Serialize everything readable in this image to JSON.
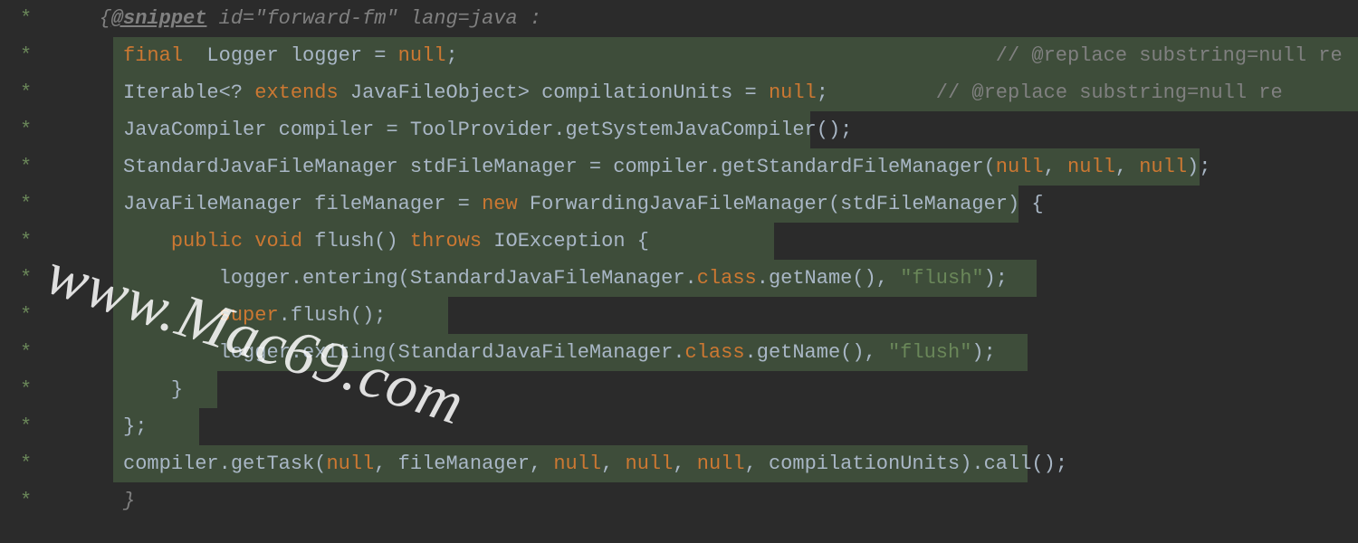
{
  "gutter_char": "*",
  "lines": [
    {
      "indent": "   ",
      "highlight": false,
      "tokens": [
        {
          "t": "{",
          "c": "comment-italic"
        },
        {
          "t": "@snippet",
          "c": "snippet-tag"
        },
        {
          "t": " id=\"forward-fm\" lang=java :",
          "c": "comment-italic"
        }
      ]
    },
    {
      "indent": "     ",
      "highlight": true,
      "hl_start": 55,
      "hl_width": 1445,
      "tokens": [
        {
          "t": "final",
          "c": "keyword"
        },
        {
          "t": "  Logger logger = ",
          "c": "identifier"
        },
        {
          "t": "null",
          "c": "keyword"
        },
        {
          "t": ";                                             ",
          "c": "identifier"
        },
        {
          "t": "// @replace substring=null re",
          "c": "comment"
        }
      ]
    },
    {
      "indent": "     ",
      "highlight": true,
      "hl_start": 55,
      "hl_width": 1445,
      "tokens": [
        {
          "t": "Iterable<? ",
          "c": "identifier"
        },
        {
          "t": "extends",
          "c": "keyword"
        },
        {
          "t": " JavaFileObject> compilationUnits = ",
          "c": "identifier"
        },
        {
          "t": "null",
          "c": "keyword"
        },
        {
          "t": ";         ",
          "c": "identifier"
        },
        {
          "t": "// @replace substring=null re",
          "c": "comment"
        }
      ]
    },
    {
      "indent": "     ",
      "highlight": true,
      "hl_start": 55,
      "hl_width": 770,
      "tokens": [
        {
          "t": "JavaCompiler compiler = ToolProvider.getSystemJavaCompiler();",
          "c": "identifier"
        }
      ]
    },
    {
      "indent": "     ",
      "highlight": true,
      "hl_start": 55,
      "hl_width": 1200,
      "tokens": [
        {
          "t": "StandardJavaFileManager stdFileManager = compiler.getStandardFileManager(",
          "c": "identifier"
        },
        {
          "t": "null",
          "c": "keyword"
        },
        {
          "t": ", ",
          "c": "identifier"
        },
        {
          "t": "null",
          "c": "keyword"
        },
        {
          "t": ", ",
          "c": "identifier"
        },
        {
          "t": "null",
          "c": "keyword"
        },
        {
          "t": ");",
          "c": "identifier"
        }
      ]
    },
    {
      "indent": "     ",
      "highlight": true,
      "hl_start": 55,
      "hl_width": 1000,
      "tokens": [
        {
          "t": "JavaFileManager fileManager = ",
          "c": "identifier"
        },
        {
          "t": "new",
          "c": "keyword"
        },
        {
          "t": " ForwardingJavaFileManager(stdFileManager) {",
          "c": "identifier"
        }
      ]
    },
    {
      "indent": "         ",
      "highlight": true,
      "hl_start": 55,
      "hl_width": 730,
      "tokens": [
        {
          "t": "public void",
          "c": "keyword"
        },
        {
          "t": " flush() ",
          "c": "identifier"
        },
        {
          "t": "throws",
          "c": "keyword"
        },
        {
          "t": " IOException {",
          "c": "identifier"
        }
      ]
    },
    {
      "indent": "             ",
      "highlight": true,
      "hl_start": 55,
      "hl_width": 1020,
      "tokens": [
        {
          "t": "logger.entering(StandardJavaFileManager.",
          "c": "identifier"
        },
        {
          "t": "class",
          "c": "keyword"
        },
        {
          "t": ".getName(), ",
          "c": "identifier"
        },
        {
          "t": "\"flush\"",
          "c": "string"
        },
        {
          "t": ");",
          "c": "identifier"
        }
      ]
    },
    {
      "indent": "             ",
      "highlight": true,
      "hl_start": 55,
      "hl_width": 370,
      "tokens": [
        {
          "t": "super",
          "c": "keyword"
        },
        {
          "t": ".flush();",
          "c": "identifier"
        }
      ]
    },
    {
      "indent": "             ",
      "highlight": true,
      "hl_start": 55,
      "hl_width": 1010,
      "tokens": [
        {
          "t": "logger.exiting(StandardJavaFileManager.",
          "c": "identifier"
        },
        {
          "t": "class",
          "c": "keyword"
        },
        {
          "t": ".getName(), ",
          "c": "identifier"
        },
        {
          "t": "\"flush\"",
          "c": "string"
        },
        {
          "t": ");",
          "c": "identifier"
        }
      ]
    },
    {
      "indent": "         ",
      "highlight": true,
      "hl_start": 55,
      "hl_width": 115,
      "tokens": [
        {
          "t": "}",
          "c": "identifier"
        }
      ]
    },
    {
      "indent": "     ",
      "highlight": true,
      "hl_start": 55,
      "hl_width": 95,
      "tokens": [
        {
          "t": "};",
          "c": "identifier"
        }
      ]
    },
    {
      "indent": "     ",
      "highlight": true,
      "hl_start": 55,
      "hl_width": 1010,
      "tokens": [
        {
          "t": "compiler.getTask(",
          "c": "identifier"
        },
        {
          "t": "null",
          "c": "keyword"
        },
        {
          "t": ", fileManager, ",
          "c": "identifier"
        },
        {
          "t": "null",
          "c": "keyword"
        },
        {
          "t": ", ",
          "c": "identifier"
        },
        {
          "t": "null",
          "c": "keyword"
        },
        {
          "t": ", ",
          "c": "identifier"
        },
        {
          "t": "null",
          "c": "keyword"
        },
        {
          "t": ", compilationUnits).call();",
          "c": "identifier"
        }
      ]
    },
    {
      "indent": "     ",
      "highlight": false,
      "tokens": [
        {
          "t": "}",
          "c": "comment-italic"
        }
      ]
    }
  ],
  "watermark": "www.Mac69.com"
}
